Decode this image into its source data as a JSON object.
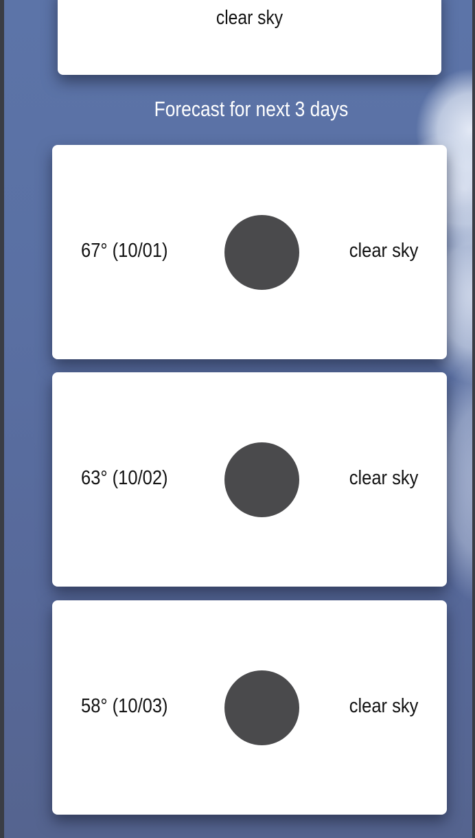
{
  "current": {
    "description": "clear sky"
  },
  "forecast": {
    "title": "Forecast for next 3 days",
    "days": [
      {
        "temp_date": "67° (10/01)",
        "icon": "weather-icon",
        "description": "clear sky"
      },
      {
        "temp_date": "63° (10/02)",
        "icon": "weather-icon",
        "description": "clear sky"
      },
      {
        "temp_date": "58° (10/03)",
        "icon": "weather-icon",
        "description": "clear sky"
      }
    ]
  },
  "colors": {
    "background": "#5a70a3",
    "card": "#ffffff",
    "icon_placeholder": "#4a4a4c",
    "text": "#111111",
    "title_text": "#ffffff"
  }
}
